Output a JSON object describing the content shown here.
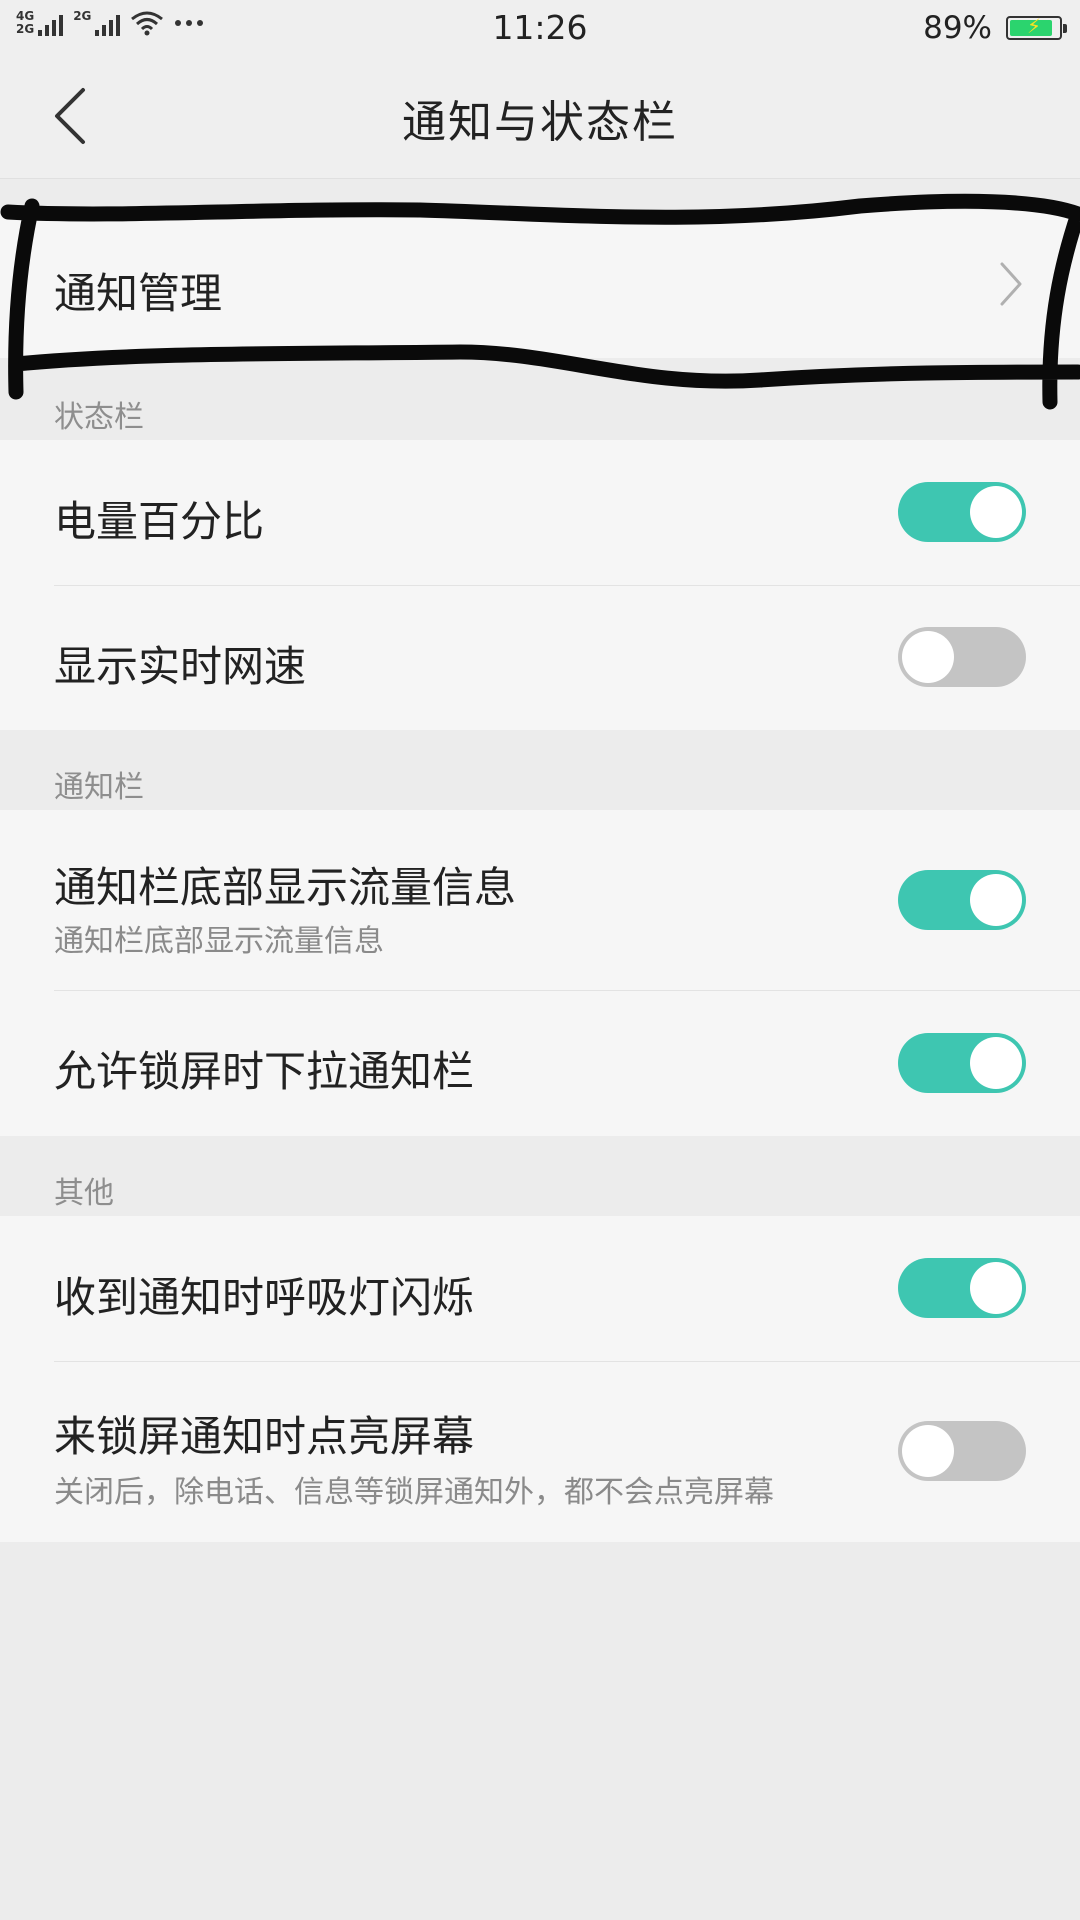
{
  "status_bar": {
    "net_top": "4G",
    "net_bottom": "2G",
    "sim2_label": "2G",
    "time": "11:26",
    "battery_text": "89%",
    "battery_level": 0.89,
    "battery_color": "#2bd46e"
  },
  "header": {
    "title": "通知与状态栏"
  },
  "notification_mgmt": {
    "label": "通知管理"
  },
  "sections": {
    "status_bar": {
      "header": "状态栏"
    },
    "notification_bar": {
      "header": "通知栏"
    },
    "other": {
      "header": "其他"
    }
  },
  "settings": {
    "battery_percentage": {
      "label": "电量百分比",
      "enabled": true
    },
    "realtime_speed": {
      "label": "显示实时网速",
      "enabled": false
    },
    "bottom_traffic": {
      "label": "通知栏底部显示流量信息",
      "sublabel": "通知栏底部显示流量信息",
      "enabled": true
    },
    "pull_on_lock": {
      "label": "允许锁屏时下拉通知栏",
      "enabled": true
    },
    "breathing_light": {
      "label": "收到通知时呼吸灯闪烁",
      "enabled": true
    },
    "wake_screen": {
      "label": "来锁屏通知时点亮屏幕",
      "sublabel": "关闭后，除电话、信息等锁屏通知外，都不会点亮屏幕",
      "enabled": false
    }
  },
  "colors": {
    "toggle_on": "#3ec6b1",
    "toggle_off": "#c4c4c4"
  }
}
